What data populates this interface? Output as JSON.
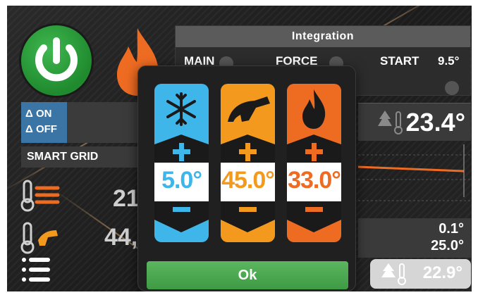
{
  "integration": {
    "title": "Integration",
    "main_label": "MAIN",
    "force_label": "FORCE",
    "start_label": "START",
    "start_value": "9.5°"
  },
  "delta": {
    "on_label": "Δ ON",
    "off_label": "Δ OFF"
  },
  "smart_grid_label": "SMART GRID",
  "left_values": {
    "heating": "21,",
    "dhw": "44,"
  },
  "right": {
    "outdoor_temp": "23.4°",
    "small_value_1": "0.1°",
    "small_value_2": "25.0°",
    "bottom_temp": "22.9°"
  },
  "modal": {
    "columns": [
      {
        "name": "cooling",
        "value": "5.0°",
        "color": "#3fb6ea"
      },
      {
        "name": "dhw",
        "value": "45.0°",
        "color": "#f39a1e"
      },
      {
        "name": "heating",
        "value": "33.0°",
        "color": "#ee6b22"
      }
    ],
    "ok_label": "Ok"
  },
  "icons": {
    "power": "power-icon",
    "flame": "flame-icon",
    "snowflake": "snowflake-icon",
    "faucet": "faucet-icon",
    "thermometer": "thermometer-icon",
    "menu": "menu-icon"
  },
  "colors": {
    "power_green": "#2ea33c",
    "flame_orange": "#ee6b22",
    "delta_blue": "#3b75a6",
    "ok_green": "#4fae54"
  }
}
